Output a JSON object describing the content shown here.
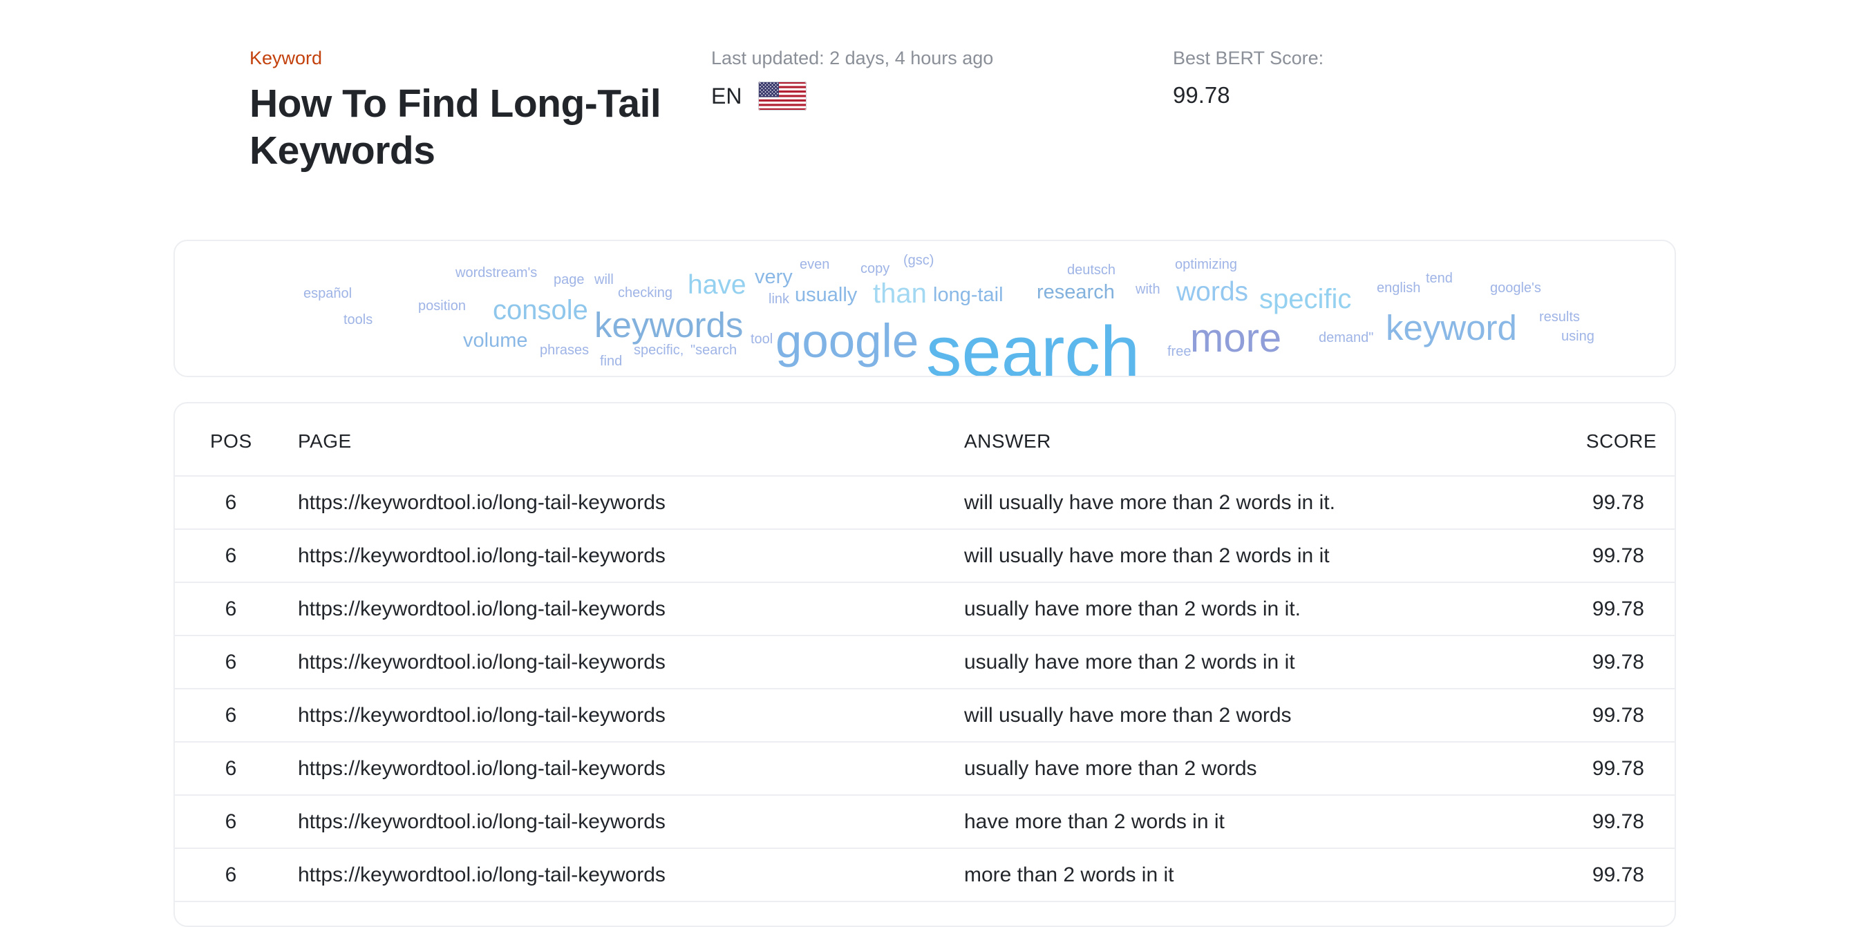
{
  "header": {
    "keyword_label": "Keyword",
    "keyword_title": "How To Find Long-Tail Keywords",
    "last_updated": "Last updated: 2 days, 4 hours ago",
    "language_code": "EN",
    "flag_icon": "us-flag-icon",
    "best_bert_label": "Best BERT Score:",
    "best_bert_value": "99.78"
  },
  "colors": {
    "keyword_label": "#c2410c",
    "title": "#22262b",
    "muted": "#8a8f98",
    "border": "#eceef1"
  },
  "word_cloud": {
    "words": [
      {
        "text": "español",
        "color": "#9fb4e6"
      },
      {
        "text": "tools",
        "color": "#9fb4e6"
      },
      {
        "text": "wordstream's",
        "color": "#9fb4e6"
      },
      {
        "text": "position",
        "color": "#9fb4e6"
      },
      {
        "text": "page",
        "color": "#9fb4e6"
      },
      {
        "text": "will",
        "color": "#9fb4e6"
      },
      {
        "text": "checking",
        "color": "#9fb4e6"
      },
      {
        "text": "console",
        "color": "#8fc6ec"
      },
      {
        "text": "volume",
        "color": "#8ab8e6"
      },
      {
        "text": "phrases",
        "color": "#9fb4e6"
      },
      {
        "text": "find",
        "color": "#9fb4e6"
      },
      {
        "text": "keywords",
        "color": "#82b1de"
      },
      {
        "text": "specific,",
        "color": "#9fb4e6"
      },
      {
        "text": "\"search",
        "color": "#9fb4e6"
      },
      {
        "text": "have",
        "color": "#94d0f0"
      },
      {
        "text": "very",
        "color": "#8ab8e6"
      },
      {
        "text": "link",
        "color": "#9fb4e6"
      },
      {
        "text": "even",
        "color": "#9fb4e6"
      },
      {
        "text": "usually",
        "color": "#8ab8e6"
      },
      {
        "text": "copy",
        "color": "#9fb4e6"
      },
      {
        "text": "(gsc)",
        "color": "#9fb4e6"
      },
      {
        "text": "tool",
        "color": "#9fb4e6"
      },
      {
        "text": "google",
        "color": "#7fb3e6"
      },
      {
        "text": "than",
        "color": "#a3d8f2"
      },
      {
        "text": "long-tail",
        "color": "#8ab8e6"
      },
      {
        "text": "search",
        "color": "#5bb7ec"
      },
      {
        "text": "deutsch",
        "color": "#9fb4e6"
      },
      {
        "text": "research",
        "color": "#82b1de"
      },
      {
        "text": "with",
        "color": "#9fb4e6"
      },
      {
        "text": "optimizing",
        "color": "#9fb4e6"
      },
      {
        "text": "words",
        "color": "#94c8f0"
      },
      {
        "text": "free",
        "color": "#9fb4e6"
      },
      {
        "text": "more",
        "color": "#8f9ed8"
      },
      {
        "text": "specific",
        "color": "#94d0f0"
      },
      {
        "text": "demand\"",
        "color": "#9fb4e6"
      },
      {
        "text": "english",
        "color": "#9fb4e6"
      },
      {
        "text": "tend",
        "color": "#9fb4e6"
      },
      {
        "text": "keyword",
        "color": "#8ab8e6"
      },
      {
        "text": "google's",
        "color": "#9fb4e6"
      },
      {
        "text": "results",
        "color": "#9fb4e6"
      },
      {
        "text": "using",
        "color": "#9fb4e6"
      }
    ]
  },
  "table": {
    "headers": {
      "pos": "POS",
      "page": "PAGE",
      "answer": "ANSWER",
      "score": "SCORE"
    },
    "rows": [
      {
        "pos": "6",
        "page": "https://keywordtool.io/long-tail-keywords",
        "answer": "will usually have more than 2 words in it.",
        "score": "99.78"
      },
      {
        "pos": "6",
        "page": "https://keywordtool.io/long-tail-keywords",
        "answer": "will usually have more than 2 words in it",
        "score": "99.78"
      },
      {
        "pos": "6",
        "page": "https://keywordtool.io/long-tail-keywords",
        "answer": "usually have more than 2 words in it.",
        "score": "99.78"
      },
      {
        "pos": "6",
        "page": "https://keywordtool.io/long-tail-keywords",
        "answer": "usually have more than 2 words in it",
        "score": "99.78"
      },
      {
        "pos": "6",
        "page": "https://keywordtool.io/long-tail-keywords",
        "answer": "will usually have more than 2 words",
        "score": "99.78"
      },
      {
        "pos": "6",
        "page": "https://keywordtool.io/long-tail-keywords",
        "answer": "usually have more than 2 words",
        "score": "99.78"
      },
      {
        "pos": "6",
        "page": "https://keywordtool.io/long-tail-keywords",
        "answer": "have more than 2 words in it",
        "score": "99.78"
      },
      {
        "pos": "6",
        "page": "https://keywordtool.io/long-tail-keywords",
        "answer": "more than 2 words in it",
        "score": "99.78"
      }
    ]
  }
}
